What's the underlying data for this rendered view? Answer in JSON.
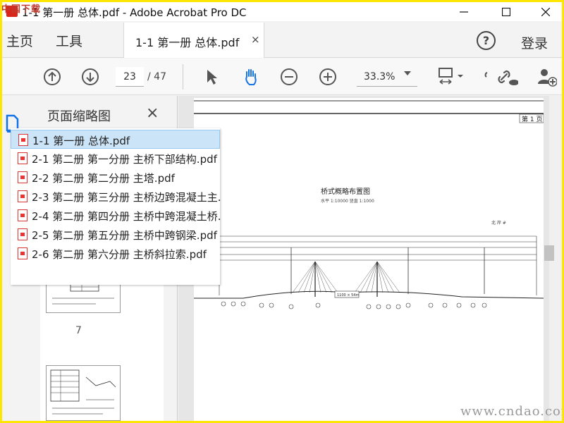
{
  "window": {
    "title": "1-1 第一册 总体.pdf - Adobe Acrobat Pro DC",
    "logo_text": "中国下载"
  },
  "nav": {
    "home": "主页",
    "tools": "工具",
    "doc_tab": "1-1 第一册 总体.pdf",
    "doc_tab_close": "×",
    "help": "?",
    "login": "登录"
  },
  "toolbar": {
    "current_page": "23",
    "total_pages": "/ 47",
    "zoom": "33.3%"
  },
  "panel": {
    "title": "页面缩略图",
    "close": "×",
    "thumb_page_number": "7"
  },
  "file_list": [
    {
      "label": "1-1 第一册 总体.pdf",
      "selected": true
    },
    {
      "label": "2-1 第二册 第一分册 主桥下部结构.pdf",
      "selected": false
    },
    {
      "label": "2-2 第二册 第二分册 主塔.pdf",
      "selected": false
    },
    {
      "label": "2-3 第二册 第三分册 主桥边跨混凝土主.",
      "selected": false
    },
    {
      "label": "2-4 第二册 第四分册 主桥中跨混凝土桥.",
      "selected": false
    },
    {
      "label": "2-5 第二册 第五分册 主桥中跨钢梁.pdf",
      "selected": false
    },
    {
      "label": "2-6 第二册 第六分册 主桥斜拉索.pdf",
      "selected": false
    }
  ],
  "document": {
    "page_badge": "第 1 页",
    "drawing_title": "桥式概略布置图",
    "drawing_subtitle": "水平 1:10000 竖直 1:1000",
    "north_label": "北 岸 #",
    "span_box": "1100 × 54m"
  },
  "watermark": "www.cndao.com",
  "colors": {
    "frame": "#ffe600",
    "selection": "#cce4f7",
    "pdf_red": "#dd3333"
  }
}
